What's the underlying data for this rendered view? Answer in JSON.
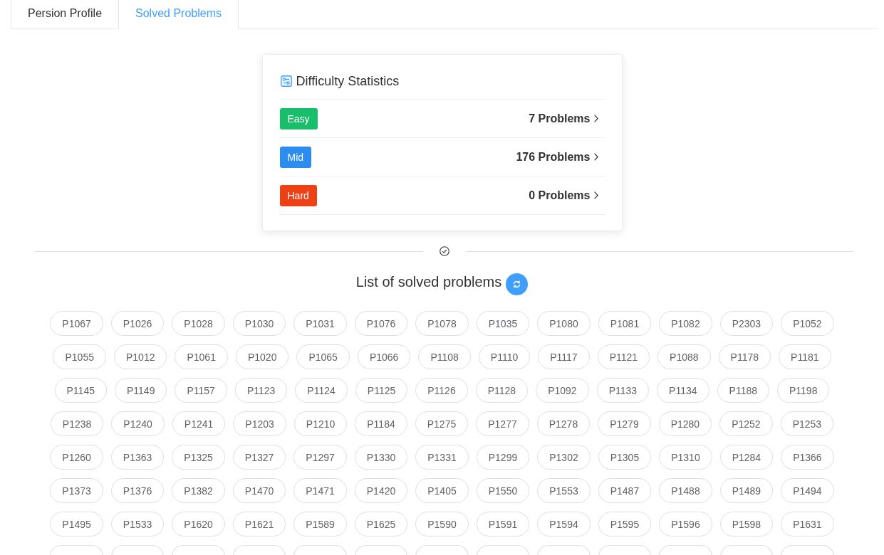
{
  "tabs": [
    {
      "label": "Persion Profile",
      "selected": false
    },
    {
      "label": "Solved Problems",
      "selected": true
    }
  ],
  "difficulty_card": {
    "title": "Difficulty Statistics",
    "rows": [
      {
        "tag": "Easy",
        "color": "#19be6b",
        "count": "7 Problems"
      },
      {
        "tag": "Mid",
        "color": "#2d8cf0",
        "count": "176 Problems"
      },
      {
        "tag": "Hard",
        "color": "#ed4014",
        "count": "0 Problems"
      }
    ]
  },
  "solved_list": {
    "title": "List of solved problems",
    "problems": [
      {
        "kind": "tag",
        "label": "P1067"
      },
      {
        "kind": "tag",
        "label": "P1026"
      },
      {
        "kind": "tag",
        "label": "P1028"
      },
      {
        "kind": "tag",
        "label": "P1030"
      },
      {
        "kind": "tag",
        "label": "P1031"
      },
      {
        "kind": "tag",
        "label": "P1076"
      },
      {
        "kind": "tag",
        "label": "P1078"
      },
      {
        "kind": "tag",
        "label": "P1035"
      },
      {
        "kind": "tag",
        "label": "P1080"
      },
      {
        "kind": "tag",
        "label": "P1081"
      },
      {
        "kind": "tag",
        "label": "P1082"
      },
      {
        "kind": "tag",
        "label": "P2303"
      },
      {
        "kind": "tag",
        "label": "P1052"
      },
      {
        "kind": "tag",
        "label": "P1055"
      },
      {
        "kind": "tag",
        "label": "P1012"
      },
      {
        "kind": "tag",
        "label": "P1061"
      },
      {
        "kind": "tag",
        "label": "P1020"
      },
      {
        "kind": "tag",
        "label": "P1065"
      },
      {
        "kind": "tag",
        "label": "P1066"
      },
      {
        "kind": "tag",
        "label": "P1108"
      },
      {
        "kind": "tag",
        "label": "P1110"
      },
      {
        "kind": "tag",
        "label": "P1117"
      },
      {
        "kind": "tag",
        "label": "P1121"
      },
      {
        "kind": "tag",
        "label": "P1088"
      },
      {
        "kind": "tag",
        "label": "P1178"
      },
      {
        "kind": "tag",
        "label": "P1181"
      },
      {
        "kind": "tag",
        "label": "P1145"
      },
      {
        "kind": "tag",
        "label": "P1149"
      },
      {
        "kind": "tag",
        "label": "P1157"
      },
      {
        "kind": "tag",
        "label": "P1123"
      },
      {
        "kind": "tag",
        "label": "P1124"
      },
      {
        "kind": "tag",
        "label": "P1125"
      },
      {
        "kind": "tag",
        "label": "P1126"
      },
      {
        "kind": "tag",
        "label": "P1128"
      },
      {
        "kind": "tag",
        "label": "P1092"
      },
      {
        "kind": "tag",
        "label": "P1133"
      },
      {
        "kind": "tag",
        "label": "P1134"
      },
      {
        "kind": "tag",
        "label": "P1188"
      },
      {
        "kind": "tag",
        "label": "P1198"
      },
      {
        "kind": "tag",
        "label": "P1238"
      },
      {
        "kind": "tag",
        "label": "P1240"
      },
      {
        "kind": "tag",
        "label": "P1241"
      },
      {
        "kind": "tag",
        "label": "P1203"
      },
      {
        "kind": "tag",
        "label": "P1210"
      },
      {
        "kind": "tag",
        "label": "P1184"
      },
      {
        "kind": "tag",
        "label": "P1275"
      },
      {
        "kind": "tag",
        "label": "P1277"
      },
      {
        "kind": "tag",
        "label": "P1278"
      },
      {
        "kind": "tag",
        "label": "P1279"
      },
      {
        "kind": "tag",
        "label": "P1280"
      },
      {
        "kind": "tag",
        "label": "P1252"
      },
      {
        "kind": "tag",
        "label": "P1253"
      },
      {
        "kind": "tag",
        "label": "P1260"
      },
      {
        "kind": "tag",
        "label": "P1363"
      },
      {
        "kind": "tag",
        "label": "P1325"
      },
      {
        "kind": "tag",
        "label": "P1327"
      },
      {
        "kind": "tag",
        "label": "P1297"
      },
      {
        "kind": "tag",
        "label": "P1330"
      },
      {
        "kind": "tag",
        "label": "P1331"
      },
      {
        "kind": "tag",
        "label": "P1299"
      },
      {
        "kind": "tag",
        "label": "P1302"
      },
      {
        "kind": "tag",
        "label": "P1305"
      },
      {
        "kind": "tag",
        "label": "P1310"
      },
      {
        "kind": "tag",
        "label": "P1284"
      },
      {
        "kind": "tag",
        "label": "P1366"
      },
      {
        "kind": "tag",
        "label": "P1373"
      },
      {
        "kind": "tag",
        "label": "P1376"
      },
      {
        "kind": "tag",
        "label": "P1382"
      },
      {
        "kind": "tag",
        "label": "P1470"
      },
      {
        "kind": "tag",
        "label": "P1471"
      },
      {
        "kind": "tag",
        "label": "P1420"
      },
      {
        "kind": "tag",
        "label": "P1405"
      },
      {
        "kind": "tag",
        "label": "P1550"
      },
      {
        "kind": "tag",
        "label": "P1553"
      },
      {
        "kind": "tag",
        "label": "P1487"
      },
      {
        "kind": "tag",
        "label": "P1488"
      },
      {
        "kind": "tag",
        "label": "P1489"
      },
      {
        "kind": "tag",
        "label": "P1494"
      },
      {
        "kind": "tag",
        "label": "P1495"
      },
      {
        "kind": "tag",
        "label": "P1533"
      },
      {
        "kind": "tag",
        "label": "P1620"
      },
      {
        "kind": "tag",
        "label": "P1621"
      },
      {
        "kind": "tag",
        "label": "P1589"
      },
      {
        "kind": "tag",
        "label": "P1625"
      },
      {
        "kind": "tag",
        "label": "P1590"
      },
      {
        "kind": "tag",
        "label": "P1591"
      },
      {
        "kind": "tag",
        "label": "P1594"
      },
      {
        "kind": "tag",
        "label": "P1595"
      },
      {
        "kind": "tag",
        "label": "P1596"
      },
      {
        "kind": "tag",
        "label": "P1598"
      },
      {
        "kind": "tag",
        "label": "P1631"
      },
      {
        "kind": "cut"
      },
      {
        "kind": "cut"
      },
      {
        "kind": "cut"
      },
      {
        "kind": "cut"
      },
      {
        "kind": "cut"
      },
      {
        "kind": "cut"
      },
      {
        "kind": "cut"
      },
      {
        "kind": "cut"
      },
      {
        "kind": "cut"
      },
      {
        "kind": "cut"
      },
      {
        "kind": "cut"
      },
      {
        "kind": "cut"
      },
      {
        "kind": "cut"
      }
    ]
  }
}
